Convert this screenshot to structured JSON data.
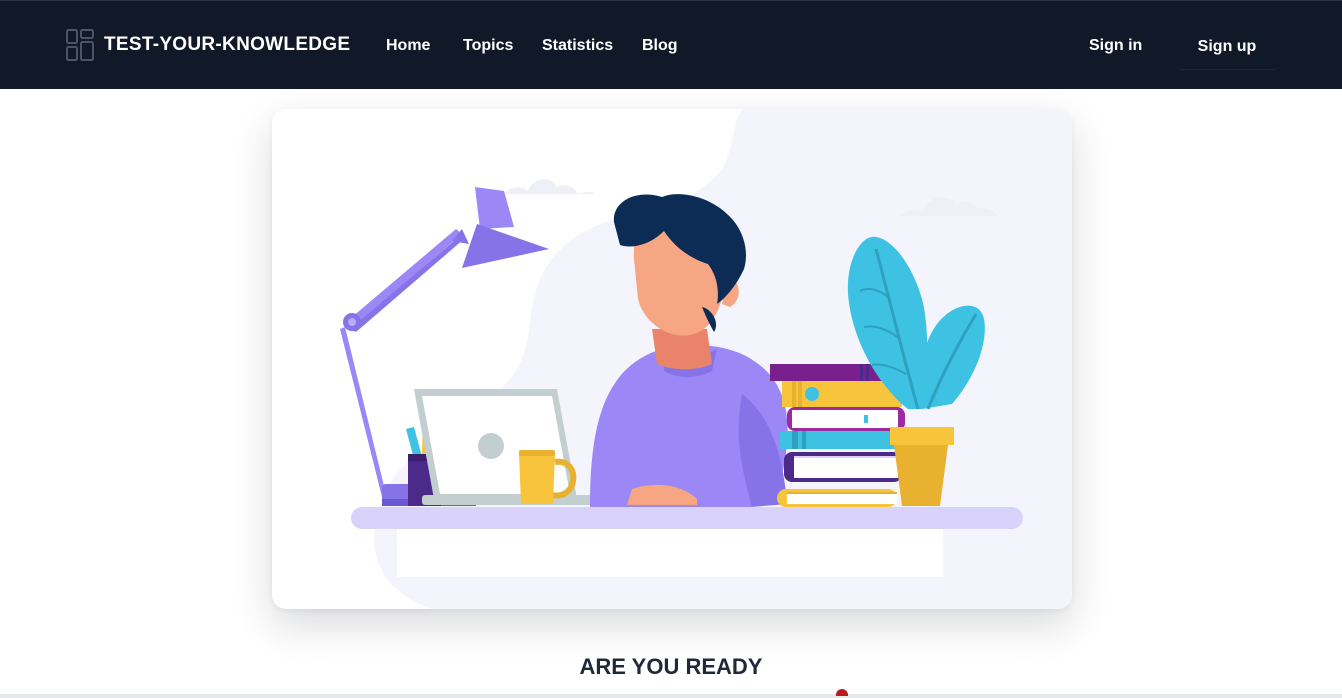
{
  "brand": {
    "name": "TEST-YOUR-KNOWLEDGE",
    "logo_icon": "grid-icon"
  },
  "nav": {
    "links": [
      {
        "label": "Home"
      },
      {
        "label": "Topics"
      },
      {
        "label": "Statistics"
      },
      {
        "label": "Blog"
      }
    ],
    "signin_label": "Sign in",
    "signup_label": "Sign up"
  },
  "hero": {
    "illustration": "student-studying-at-desk-illustration",
    "illustration_alt": "Student studying at desk with laptop, lamp, books and plant"
  },
  "main": {
    "heading": "ARE YOU READY"
  },
  "colors": {
    "navbar_bg": "#111827",
    "text_dark": "#1f2937",
    "accent_purple": "#9b87f5",
    "accent_blue": "#3ec2e3",
    "accent_yellow": "#f8c43c"
  }
}
